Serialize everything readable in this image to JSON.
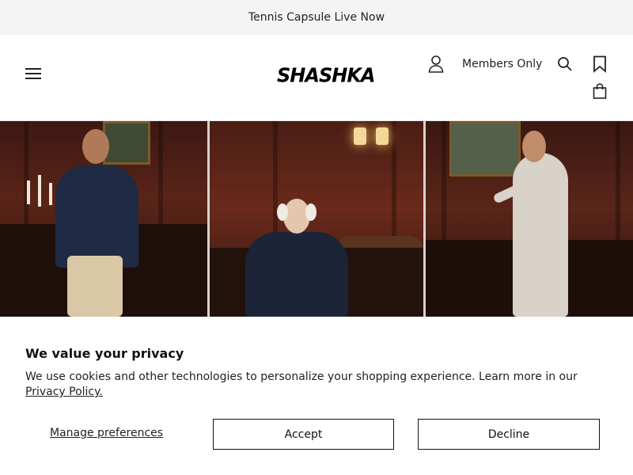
{
  "announcement": {
    "text": "Tennis Capsule Live Now"
  },
  "header": {
    "logo": "SHASHKA",
    "members_label": "Members Only",
    "icons": [
      "menu-icon",
      "user-icon",
      "search-icon",
      "bookmark-icon",
      "bag-icon"
    ]
  },
  "cookie_banner": {
    "title": "We value your privacy",
    "text": "We use cookies and other technologies to personalize your shopping experience. Learn more in our ",
    "policy_link": "Privacy Policy.",
    "manage_label": "Manage preferences",
    "accept_label": "Accept",
    "decline_label": "Decline"
  }
}
